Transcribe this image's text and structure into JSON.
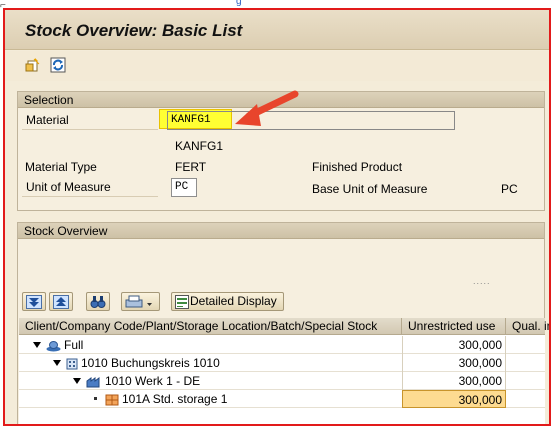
{
  "window": {
    "title": "Stock Overview: Basic List"
  },
  "toolbar": {
    "icons": [
      "selection-screen-icon",
      "refresh-icon"
    ]
  },
  "selection": {
    "header": "Selection",
    "material_label": "Material",
    "material_value": "KANFG1",
    "material_desc": "KANFG1",
    "material_type_label": "Material Type",
    "material_type_value": "FERT",
    "material_type_text": "Finished Product",
    "uom_label": "Unit of Measure",
    "uom_value": "PC",
    "base_uom_label": "Base Unit of Measure",
    "base_uom_value": "PC"
  },
  "stock": {
    "header": "Stock Overview",
    "detailed_display_label": "Detailed Display",
    "columns": [
      "Client/Company Code/Plant/Storage Location/Batch/Special Stock",
      "Unrestricted use",
      "Qual. in"
    ],
    "rows": [
      {
        "label": "Full",
        "value": "300,000"
      },
      {
        "label": "1010 Buchungskreis 1010",
        "value": "300,000"
      },
      {
        "label": "1010 Werk 1 - DE",
        "value": "300,000"
      },
      {
        "label": "101A Std. storage 1",
        "value": "300,000"
      }
    ]
  },
  "colors": {
    "accent_highlight": "#ffff33",
    "frame_border": "#e21a1a",
    "selected_cell": "#fddb91",
    "arrow": "#e8452c"
  }
}
